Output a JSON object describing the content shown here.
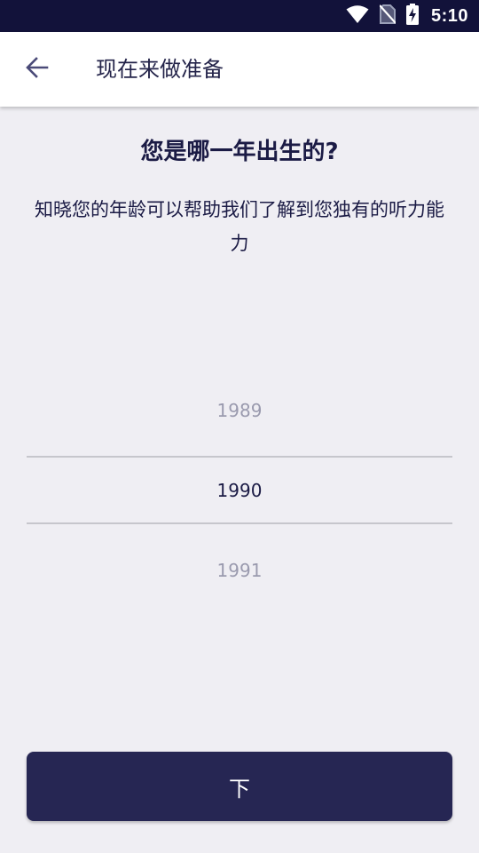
{
  "status_bar": {
    "time": "5:10",
    "icons": [
      "wifi-icon",
      "no-sim-icon",
      "battery-charging-icon"
    ],
    "background": "#12123a"
  },
  "app_bar": {
    "back_icon": "arrow-left-icon",
    "title": "现在来做准备"
  },
  "main": {
    "question": "您是哪一年出生的?",
    "description": "知晓您的年龄可以帮助我们了解到您独有的听力能力"
  },
  "year_picker": {
    "previous": "1989",
    "selected": "1990",
    "next": "1991"
  },
  "next_button": {
    "label": "下",
    "color": "#262653"
  },
  "colors": {
    "page_background": "#efeef3",
    "text_primary": "#1b1b45",
    "text_muted": "#9a9aae"
  }
}
